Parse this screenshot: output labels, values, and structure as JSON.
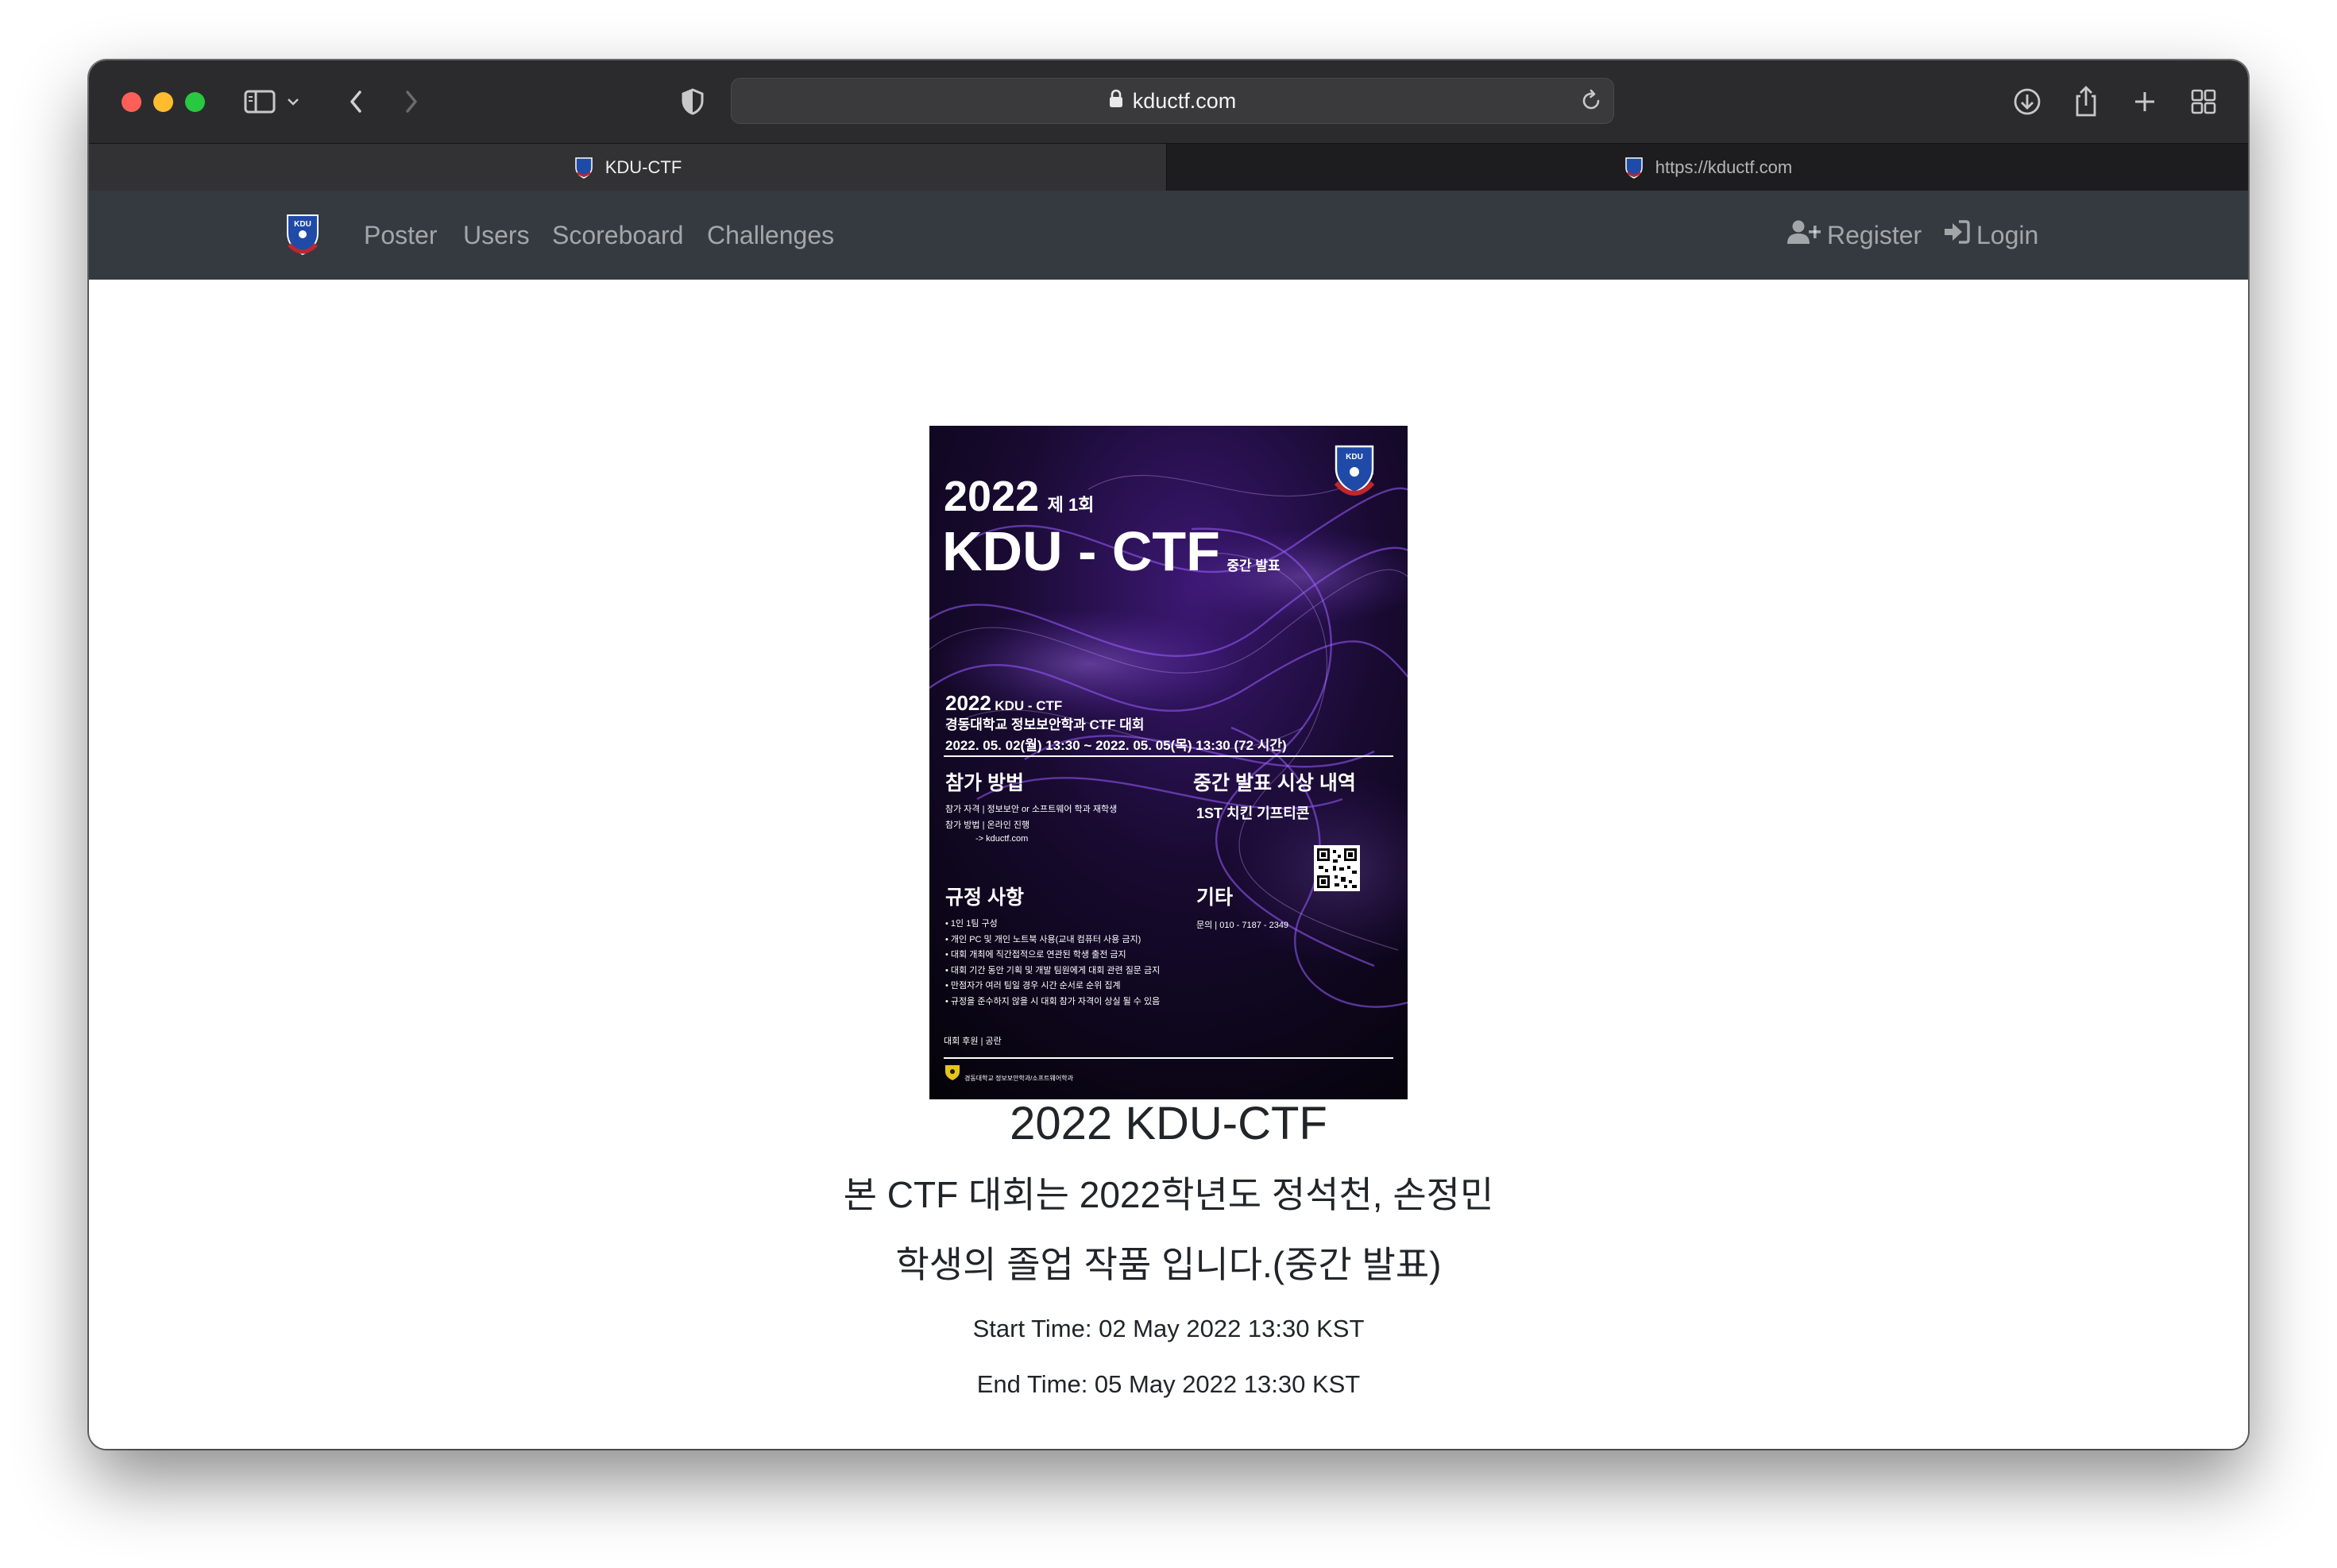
{
  "browser": {
    "url": "kductf.com",
    "tabs": [
      {
        "label": "KDU-CTF"
      },
      {
        "label": "https://kductf.com"
      }
    ]
  },
  "navbar": {
    "items": [
      "Poster",
      "Users",
      "Scoreboard",
      "Challenges"
    ],
    "register": "Register",
    "login": "Login"
  },
  "poster": {
    "year": "2022",
    "edition": "제 1회",
    "title": "KDU - CTF",
    "title_sub": "중간 발표",
    "subtitle_year": "2022",
    "subtitle_name": "KDU - CTF",
    "subtitle_line2": "경동대학교 정보보안학과 CTF 대회",
    "dates": "2022. 05. 02(월) 13:30 ~ 2022. 05. 05(목) 13:30 (72 시간)",
    "how_title": "참가 방법",
    "how_lines": [
      "참가 자격 | 정보보안 or 소프트웨어 학과 재학생",
      "참가 방법 | 온라인 진행",
      "-> kductf.com"
    ],
    "prize_title": "중간 발표 시상 내역",
    "prize_text": "1ST 치킨 기프티콘",
    "rules_title": "규정 사항",
    "rules": [
      "• 1인 1팀 구성",
      "• 개인 PC 및 개인 노트북 사용(교내 컴퓨터 사용 금지)",
      "• 대회 개최에 직간접적으로 연관된 학생 출전 금지",
      "• 대회 기간 동안 기획 및 개발 팀원에게 대회 관련 질문 금지",
      "• 만점자가 여러 팀일 경우 시간 순서로 순위 집계",
      "• 규정을 준수하지 않을 시 대회 참가 자격이 상실 될 수 있음"
    ],
    "etc_title": "기타",
    "etc_text": "문의 | 010 - 7187 - 2349",
    "sponsor": "대회 후원 |  공란",
    "footer": "경동대학교 정보보안학과/소프트웨어학과",
    "logo_text": "KDU"
  },
  "main": {
    "title": "2022 KDU-CTF",
    "desc_line1": "본 CTF 대회는 2022학년도 정석천, 손정민",
    "desc_line2": "학생의 졸업 작품 입니다.(중간 발표)",
    "start_time": "Start Time: 02 May 2022 13:30 KST",
    "end_time": "End Time: 05 May 2022 13:30 KST"
  }
}
